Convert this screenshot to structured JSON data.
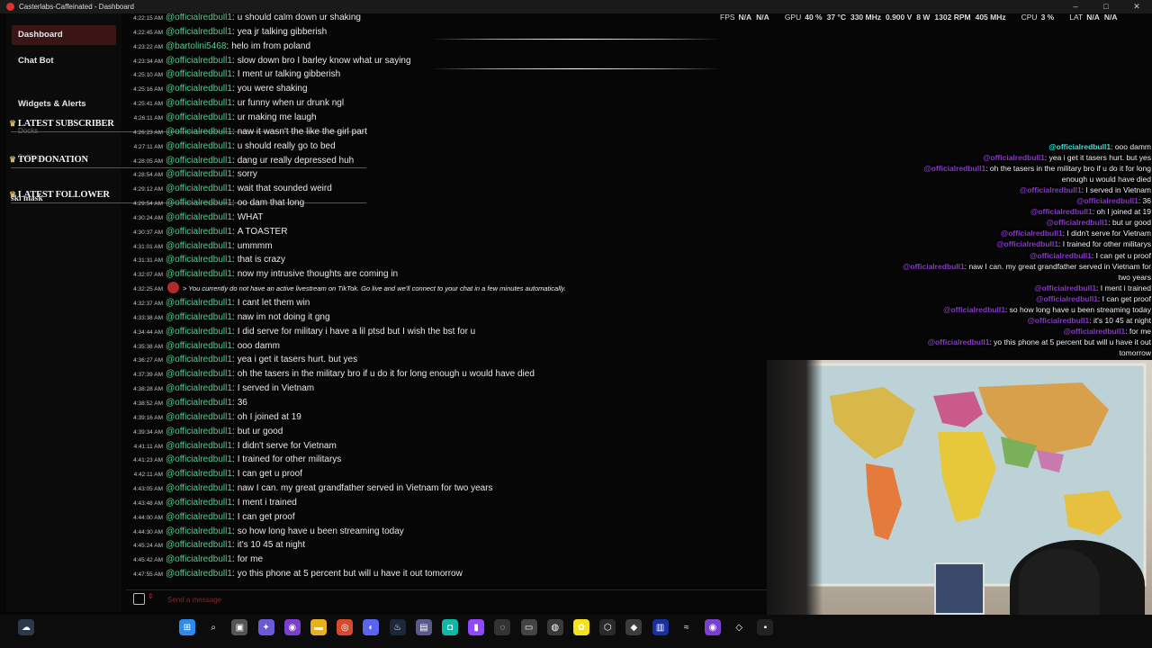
{
  "window": {
    "title": "Casterlabs-Caffeinated - Dashboard"
  },
  "sidebar": {
    "items": [
      {
        "label": "Dashboard"
      },
      {
        "label": "Chat Bot"
      },
      {
        "label": "Widgets & Alerts"
      },
      {
        "label": "Docks"
      },
      {
        "label": "Settings"
      }
    ],
    "overlay_labels": [
      {
        "label": "LATEST SUBSCRIBER"
      },
      {
        "label": "TOP DONATION"
      },
      {
        "label": "LATEST FOLLOWER"
      }
    ],
    "follower_name": "ski mask"
  },
  "chat": {
    "messages": [
      {
        "time": "4:22:15 AM",
        "user": "@officialredbull1",
        "text": "u should calm down ur shaking"
      },
      {
        "time": "4:22:45 AM",
        "user": "@officialredbull1",
        "text": "yea jr talking gibberish"
      },
      {
        "time": "4:23:22 AM",
        "user": "@bartolini5468",
        "text": "helo im from poland"
      },
      {
        "time": "4:23:34 AM",
        "user": "@officialredbull1",
        "text": "slow down bro I barley know what ur saying"
      },
      {
        "time": "4:25:10 AM",
        "user": "@officialredbull1",
        "text": "I ment ur talking gibberish"
      },
      {
        "time": "4:25:16 AM",
        "user": "@officialredbull1",
        "text": "you were shaking"
      },
      {
        "time": "4:25:41 AM",
        "user": "@officialredbull1",
        "text": "ur funny when ur drunk ngl"
      },
      {
        "time": "4:26:11 AM",
        "user": "@officialredbull1",
        "text": "ur making me laugh"
      },
      {
        "time": "4:26:23 AM",
        "user": "@officialredbull1",
        "text": "naw it wasn't the like the girl part"
      },
      {
        "time": "4:27:11 AM",
        "user": "@officialredbull1",
        "text": "u should really go to bed"
      },
      {
        "time": "4:28:05 AM",
        "user": "@officialredbull1",
        "text": "dang ur really depressed huh"
      },
      {
        "time": "4:28:54 AM",
        "user": "@officialredbull1",
        "text": "sorry"
      },
      {
        "time": "4:29:12 AM",
        "user": "@officialredbull1",
        "text": "wait that sounded weird"
      },
      {
        "time": "4:29:54 AM",
        "user": "@officialredbull1",
        "text": "oo dam that long"
      },
      {
        "time": "4:30:24 AM",
        "user": "@officialredbull1",
        "text": "WHAT"
      },
      {
        "time": "4:30:37 AM",
        "user": "@officialredbull1",
        "text": "A TOASTER"
      },
      {
        "time": "4:31:01 AM",
        "user": "@officialredbull1",
        "text": "ummmm"
      },
      {
        "time": "4:31:31 AM",
        "user": "@officialredbull1",
        "text": "that is crazy"
      },
      {
        "time": "4:32:07 AM",
        "user": "@officialredbull1",
        "text": "now my intrusive thoughts are coming in"
      },
      {
        "time": "4:32:25 AM",
        "system": true,
        "text": "> You currently do not have an active livestream on TikTok. Go live and we'll connect to your chat in a few minutes automatically."
      },
      {
        "time": "4:32:37 AM",
        "user": "@officialredbull1",
        "text": "I cant let them win"
      },
      {
        "time": "4:33:38 AM",
        "user": "@officialredbull1",
        "text": "naw im not doing it gng"
      },
      {
        "time": "4:34:44 AM",
        "user": "@officialredbull1",
        "text": "I did serve for military i have a lil ptsd but I wish the bst for u"
      },
      {
        "time": "4:35:38 AM",
        "user": "@officialredbull1",
        "text": "ooo damm"
      },
      {
        "time": "4:36:27 AM",
        "user": "@officialredbull1",
        "text": "yea i get it tasers hurt. but yes"
      },
      {
        "time": "4:37:39 AM",
        "user": "@officialredbull1",
        "text": "oh the tasers in the military bro if u do it for long enough u would have died"
      },
      {
        "time": "4:38:28 AM",
        "user": "@officialredbull1",
        "text": "I served in Vietnam"
      },
      {
        "time": "4:38:52 AM",
        "user": "@officialredbull1",
        "text": "36"
      },
      {
        "time": "4:39:16 AM",
        "user": "@officialredbull1",
        "text": "oh I joined at 19"
      },
      {
        "time": "4:39:34 AM",
        "user": "@officialredbull1",
        "text": "but ur good"
      },
      {
        "time": "4:41:11 AM",
        "user": "@officialredbull1",
        "text": "I didn't serve for Vietnam"
      },
      {
        "time": "4:41:23 AM",
        "user": "@officialredbull1",
        "text": "I trained for other militarys"
      },
      {
        "time": "4:42:11 AM",
        "user": "@officialredbull1",
        "text": "I can get u proof"
      },
      {
        "time": "4:43:05 AM",
        "user": "@officialredbull1",
        "text": "naw I can. my great grandfather served in Vietnam for two years"
      },
      {
        "time": "4:43:48 AM",
        "user": "@officialredbull1",
        "text": "I ment i trained"
      },
      {
        "time": "4:44:00 AM",
        "user": "@officialredbull1",
        "text": "I can get proof"
      },
      {
        "time": "4:44:30 AM",
        "user": "@officialredbull1",
        "text": "so how long have u been streaming today"
      },
      {
        "time": "4:45:24 AM",
        "user": "@officialredbull1",
        "text": "it's 10 45 at night"
      },
      {
        "time": "4:45:42 AM",
        "user": "@officialredbull1",
        "text": "for me"
      },
      {
        "time": "4:47:55 AM",
        "user": "@officialredbull1",
        "text": "yo this phone at 5 percent but will u have it out tomorrow"
      }
    ],
    "input_placeholder": "Send a message"
  },
  "stats": {
    "fps_label": "FPS",
    "fps_value": "N/A",
    "fps_value2": "N/A",
    "gpu_label": "GPU",
    "gpu_load": "40 %",
    "gpu_temp": "37 °C",
    "gpu_clock": "330 MHz",
    "gpu_volt": "0.900 V",
    "gpu_power": "8 W",
    "gpu_fan": "1302 RPM",
    "gpu_mem": "405 MHz",
    "cpu_label": "CPU",
    "cpu_load": "3 %",
    "lat_label": "LAT",
    "lat_value": "N/A",
    "lat_value2": "N/A"
  },
  "overlay_chat": {
    "lines": [
      {
        "user": "@officialredbull1",
        "text": ": ooo damm",
        "cyan": true
      },
      {
        "user": "@officialredbull1",
        "text": ": yea i get it tasers hurt. but yes"
      },
      {
        "user": "@officialredbull1",
        "text": ": oh the tasers in the military bro if u do it for long"
      },
      {
        "user": "",
        "text": "enough u would have died"
      },
      {
        "user": "@officialredbull1",
        "text": ": I served in Vietnam"
      },
      {
        "user": "@officialredbull1",
        "text": ": 36"
      },
      {
        "user": "@officialredbull1",
        "text": ": oh I joined at 19"
      },
      {
        "user": "@officialredbull1",
        "text": ": but ur good"
      },
      {
        "user": "@officialredbull1",
        "text": ": I didn't serve for Vietnam"
      },
      {
        "user": "@officialredbull1",
        "text": ": I trained for other militarys"
      },
      {
        "user": "@officialredbull1",
        "text": ": I can get u proof"
      },
      {
        "user": "@officialredbull1",
        "text": ": naw I can. my great grandfather served in Vietnam for"
      },
      {
        "user": "",
        "text": "two years"
      },
      {
        "user": "@officialredbull1",
        "text": ": I ment i trained"
      },
      {
        "user": "@officialredbull1",
        "text": ": I can get proof"
      },
      {
        "user": "@officialredbull1",
        "text": ": so how long have u been streaming today"
      },
      {
        "user": "@officialredbull1",
        "text": ": it's 10 45 at night"
      },
      {
        "user": "@officialredbull1",
        "text": ": for me"
      },
      {
        "user": "@officialredbull1",
        "text": ": yo this phone at 5 percent but will u have it out"
      },
      {
        "user": "",
        "text": "tomorrow"
      }
    ]
  },
  "taskbar": {
    "icons": [
      {
        "name": "windows-start-icon",
        "color": "#2b8cf0",
        "glyph": "⊞"
      },
      {
        "name": "search-icon",
        "color": "#0c0c0c",
        "glyph": "⌕"
      },
      {
        "name": "task-view-icon",
        "color": "#555555",
        "glyph": "▣"
      },
      {
        "name": "copilot-icon",
        "color": "#6a5ad8",
        "glyph": "✦"
      },
      {
        "name": "app-purple-icon",
        "color": "#7b3fd0",
        "glyph": "◉"
      },
      {
        "name": "file-explorer-icon",
        "color": "#e8b020",
        "glyph": "▬"
      },
      {
        "name": "chrome-icon",
        "color": "#d94a2c",
        "glyph": "◎"
      },
      {
        "name": "discord-icon",
        "color": "#5865f2",
        "glyph": "◐"
      },
      {
        "name": "steam-icon",
        "color": "#1b2838",
        "glyph": "♨"
      },
      {
        "name": "app-icon",
        "color": "#5a5a8a",
        "glyph": "▤"
      },
      {
        "name": "app-teal-icon",
        "color": "#10b8a8",
        "glyph": "◘"
      },
      {
        "name": "twitch-icon",
        "color": "#9146ff",
        "glyph": "▮"
      },
      {
        "name": "app-circle-icon",
        "color": "#333333",
        "glyph": "◌"
      },
      {
        "name": "terminal-icon",
        "color": "#444444",
        "glyph": "▭"
      },
      {
        "name": "obs-icon",
        "color": "#3a3a3a",
        "glyph": "◍"
      },
      {
        "name": "snapchat-icon",
        "color": "#f5e21a",
        "glyph": "✿"
      },
      {
        "name": "app-hex-icon",
        "color": "#2a2a2a",
        "glyph": "⬡"
      },
      {
        "name": "app-gray-icon",
        "color": "#3c3c3c",
        "glyph": "◆"
      },
      {
        "name": "app-blue-icon",
        "color": "#1a2fa0",
        "glyph": "▥"
      },
      {
        "name": "app-wave-icon",
        "color": "#0c0c0c",
        "glyph": "≈"
      },
      {
        "name": "app-violet-icon",
        "color": "#7b3fd0",
        "glyph": "◉"
      },
      {
        "name": "app-dark-icon",
        "color": "#0c0c0c",
        "glyph": "◇"
      },
      {
        "name": "app-square-icon",
        "color": "#222222",
        "glyph": "▪"
      }
    ]
  }
}
